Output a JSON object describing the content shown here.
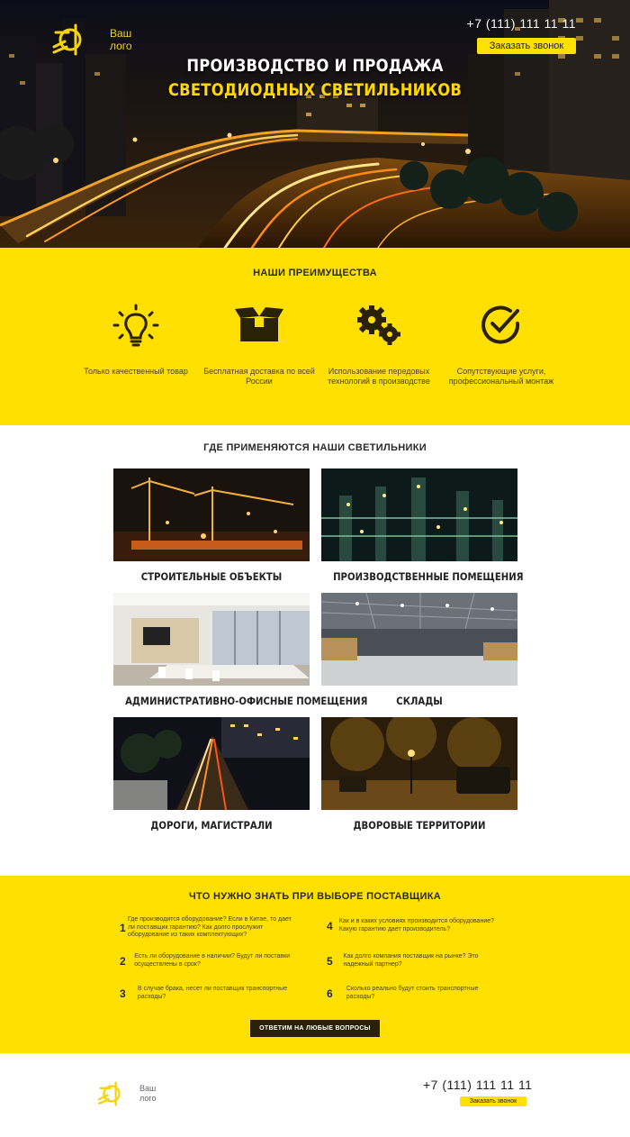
{
  "header": {
    "logo_text_line1": "Ваш",
    "logo_text_line2": "лого",
    "phone": "+7 (111) 111 11 11",
    "call_button": "Заказать звонок",
    "title_line1": "ПРОИЗВОДСТВО И ПРОДАЖА",
    "title_line2": "СВЕТОДИОДНЫХ СВЕТИЛЬНИКОВ"
  },
  "advantages": {
    "title": "НАШИ ПРЕИМУЩЕСТВА",
    "items": [
      {
        "icon": "lightbulb-icon",
        "label": "Только качественный товар"
      },
      {
        "icon": "box-icon",
        "label": "Бесплатная доставка по всей России"
      },
      {
        "icon": "gears-icon",
        "label": "Использование передовых технологий в производстве"
      },
      {
        "icon": "check-circle-icon",
        "label": "Сопутствующие услуги, профессиональный монтаж"
      }
    ]
  },
  "applications": {
    "title": "ГДЕ ПРИМЕНЯЮТСЯ НАШИ СВЕТИЛЬНИКИ",
    "items": [
      {
        "caption": "СТРОИТЕЛЬНЫЕ ОБЪЕКТЫ"
      },
      {
        "caption": "ПРОИЗВОДСТВЕННЫЕ ПОМЕЩЕНИЯ"
      },
      {
        "caption": "АДМИНИСТРАТИВНО-ОФИСНЫЕ ПОМЕЩЕНИЯ"
      },
      {
        "caption": "СКЛАДЫ"
      },
      {
        "caption": "ДОРОГИ, МАГИСТРАЛИ"
      },
      {
        "caption": "ДВОРОВЫЕ ТЕРРИТОРИИ"
      }
    ]
  },
  "faq": {
    "title": "ЧТО НУЖНО ЗНАТЬ ПРИ ВЫБОРЕ ПОСТАВЩИКА",
    "items": [
      {
        "num": "1",
        "text": "Где производится оборудование? Если в Китае, то дает ли поставщик гарантию? Как долго прослужит оборудование из таких комплектующих?"
      },
      {
        "num": "2",
        "text": "Есть ли оборудование в наличии? Будут ли поставки осуществлены в срок?"
      },
      {
        "num": "3",
        "text": "В случае брака, несет ли поставщик транспортные расходы?"
      },
      {
        "num": "4",
        "text": "Как и в каких условиях производится оборудование? Какую гарантию дает производитель?"
      },
      {
        "num": "5",
        "text": "Как долго компания поставщик на рынке? Это надежный партнер?"
      },
      {
        "num": "6",
        "text": "Сколько реально будут стоить транспортные расходы?"
      }
    ],
    "button": "ОТВЕТИМ НА ЛЮБЫЕ ВОПРОСЫ"
  },
  "footer": {
    "logo_text_line1": "Ваш",
    "logo_text_line2": "лого",
    "phone": "+7 (111) 111 11 11",
    "call_button": "Заказать звонок"
  },
  "colors": {
    "accent": "#ffe000",
    "dark": "#222222",
    "button_dark": "#2a2108"
  }
}
